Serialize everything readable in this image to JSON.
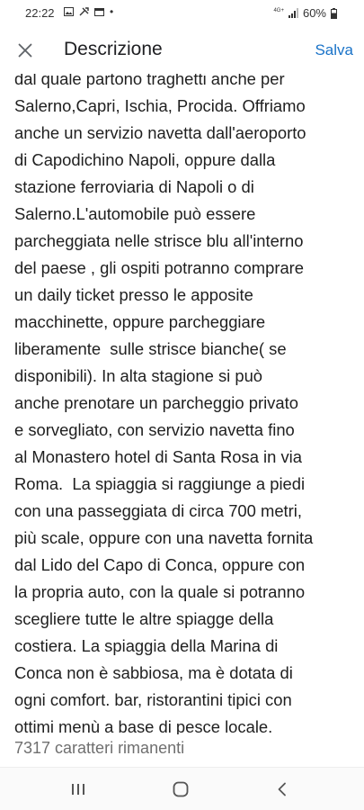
{
  "status_bar": {
    "time": "22:22",
    "network": "4G+",
    "battery": "60%"
  },
  "app_bar": {
    "title": "Descrizione",
    "save_label": "Salva"
  },
  "description_lines": [
    "dal quale partono traghetti anche per",
    "Salerno,Capri, Ischia, Procida. Offriamo",
    "anche un servizio navetta dall'aeroporto",
    "di Capodichino Napoli, oppure dalla",
    "stazione ferroviaria di Napoli o di",
    "Salerno.L'automobile può essere",
    "parcheggiata nelle strisce blu all'interno",
    "del paese , gli ospiti potranno comprare",
    "un daily ticket presso le apposite",
    "macchinette, oppure parcheggiare",
    "liberamente  sulle strisce bianche( se",
    "disponibili). In alta stagione si può",
    "anche prenotare un parcheggio privato",
    "e sorvegliato, con servizio navetta fino",
    "al Monastero hotel di Santa Rosa in via",
    "Roma.  La spiaggia si raggiunge a piedi",
    "con una passeggiata di circa 700 metri,",
    "più scale, oppure con una navetta fornita",
    "dal Lido del Capo di Conca, oppure con",
    "la propria auto, con la quale si potranno",
    "scegliere tutte le altre spiagge della",
    "costiera. La spiaggia della Marina di",
    "Conca non è sabbiosa, ma è dotata di",
    "ogni comfort. bar, ristorantini tipici con",
    "ottimi menù a base di pesce locale."
  ],
  "char_counter": "7317 caratteri rimanenti",
  "colors": {
    "accent": "#1a73c8",
    "text": "#1f1f1f",
    "secondary_text": "#6f6f6f"
  },
  "icons": {
    "close": "close-icon",
    "recents": "recent-apps-icon",
    "home": "home-icon",
    "back": "back-icon"
  }
}
